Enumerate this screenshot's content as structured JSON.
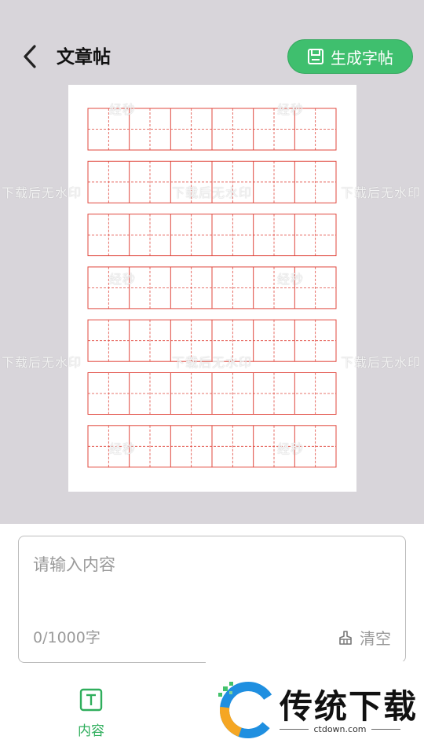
{
  "header": {
    "title": "文章帖",
    "generate_button": "生成字帖"
  },
  "paper": {
    "watermark_short": "经秒",
    "watermark_long": "下载后无水印",
    "rows": 7,
    "cells_per_row": 6,
    "grid_color": "#e0473d"
  },
  "editor": {
    "placeholder": "请输入内容",
    "value": "",
    "counter": "0/1000字",
    "clear_label": "清空"
  },
  "tabs": [
    {
      "label": "内容",
      "icon": "text-icon",
      "active": true
    }
  ],
  "overlay_logo": {
    "name": "传统下载",
    "url": "ctdown.com"
  },
  "colors": {
    "accent": "#3fbf6e",
    "background": "#d8d5da"
  }
}
